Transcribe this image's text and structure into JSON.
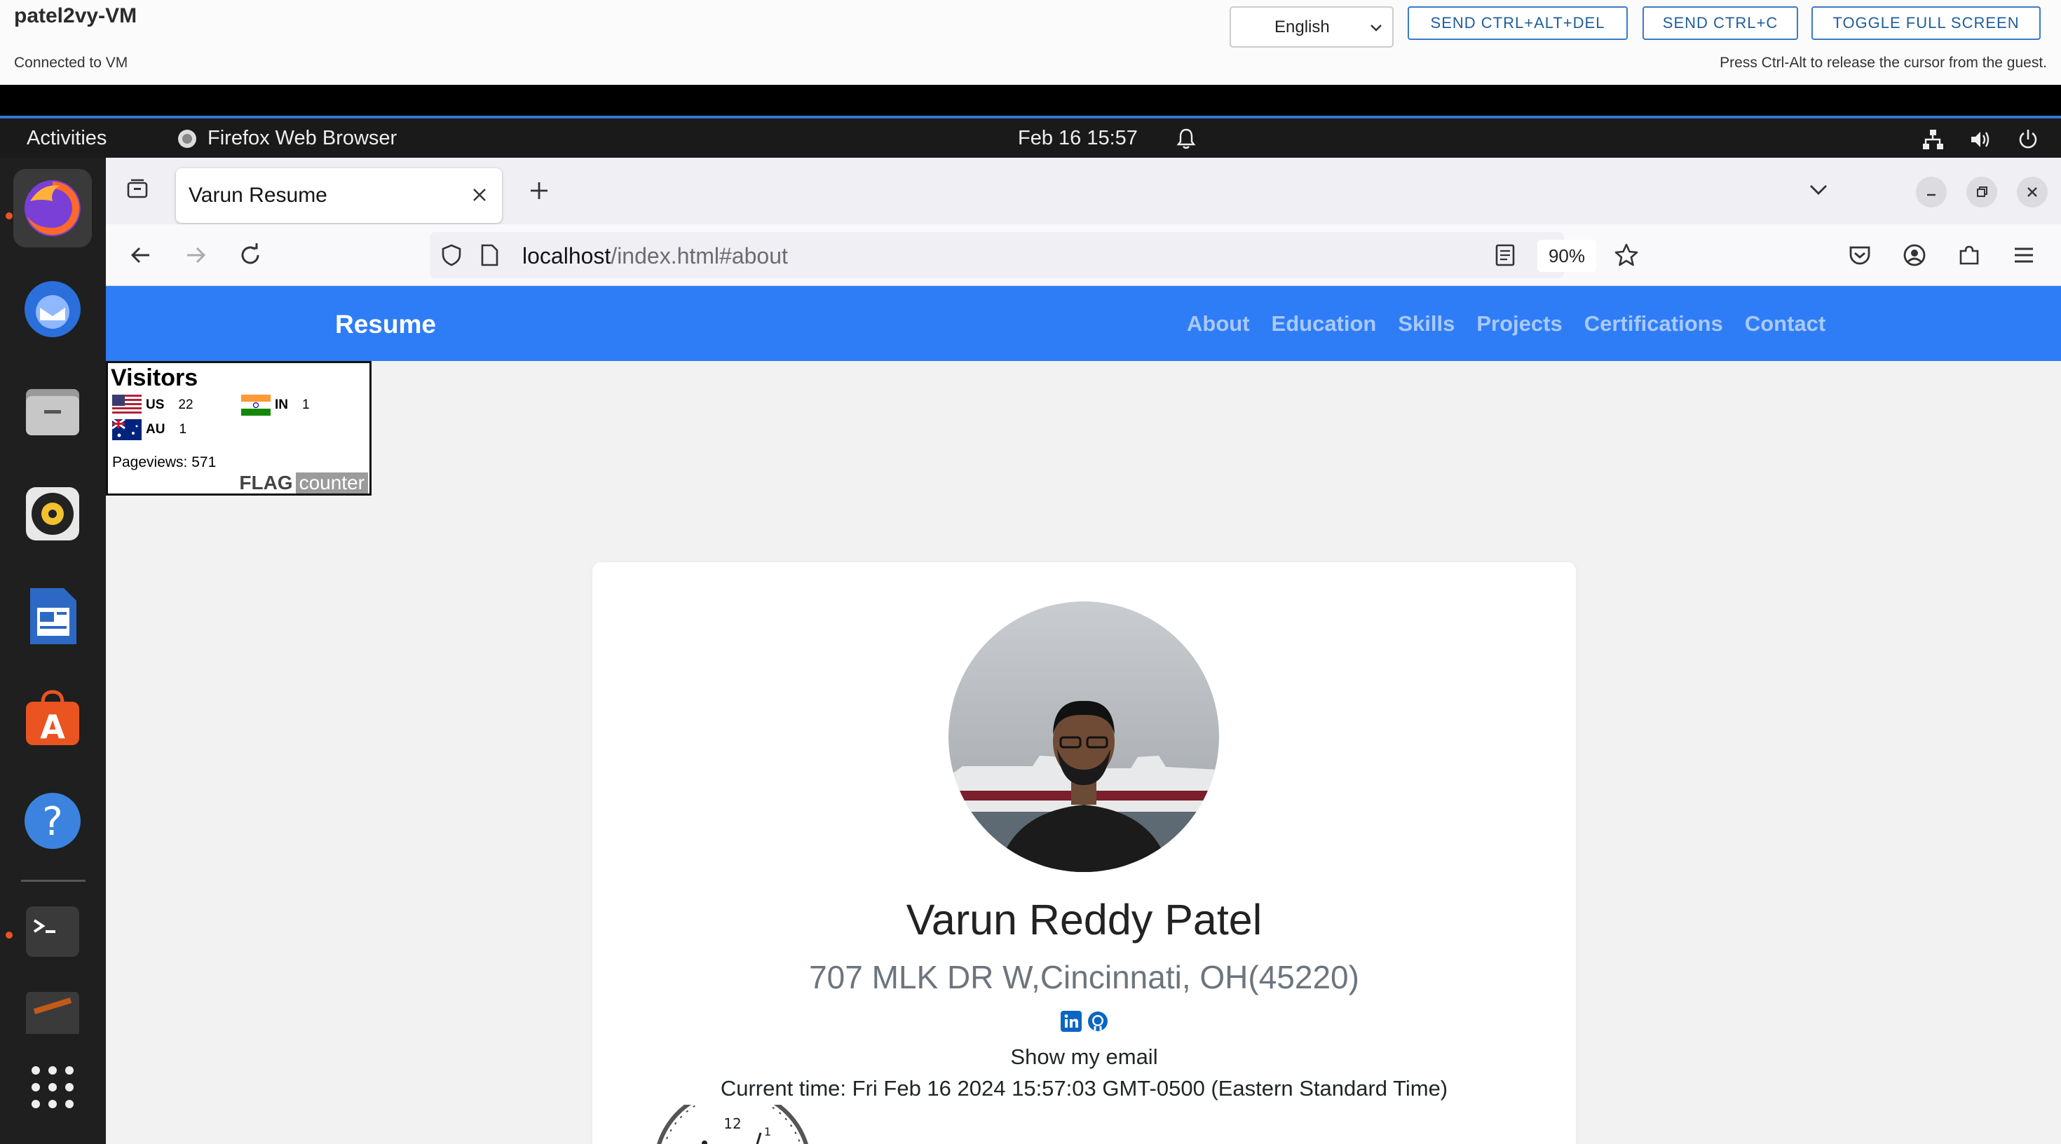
{
  "vm": {
    "title": "patel2vy-VM",
    "status": "Connected to VM",
    "language": "English",
    "buttons": {
      "ctrl_alt_del": "SEND CTRL+ALT+DEL",
      "ctrl_c": "SEND CTRL+C",
      "fullscreen": "TOGGLE FULL SCREEN"
    },
    "release_hint": "Press Ctrl-Alt to release the cursor from the guest."
  },
  "ubuntu": {
    "activities": "Activities",
    "app_name": "Firefox Web Browser",
    "clock": "Feb 16  15:57",
    "accent": "#e95420"
  },
  "dock": {
    "items": [
      "firefox",
      "thunderbird",
      "files",
      "rhythmbox",
      "libreoffice-writer",
      "ubuntu-software",
      "help",
      "terminal",
      "drive",
      "show-applications"
    ]
  },
  "browser": {
    "tab_title": "Varun Resume",
    "url_host": "localhost",
    "url_path": "/index.html#about",
    "zoom": "90%"
  },
  "site": {
    "brand": "Resume",
    "nav": [
      "About",
      "Education",
      "Skills",
      "Projects",
      "Certifications",
      "Contact"
    ],
    "brand_color": "#2f7df6"
  },
  "flag_counter": {
    "title": "Visitors",
    "rows": [
      {
        "code": "US",
        "count": "22"
      },
      {
        "code": "IN",
        "count": "1"
      },
      {
        "code": "AU",
        "count": "1"
      }
    ],
    "pageviews_label": "Pageviews:",
    "pageviews": "571",
    "logo_flag": "FLAG",
    "logo_counter": "counter"
  },
  "profile": {
    "name": "Varun Reddy Patel",
    "address": "707 MLK DR W,Cincinnati, OH(45220)",
    "show_email": "Show my email",
    "current_time": "Current time: Fri Feb 16 2024 15:57:03 GMT-0500 (Eastern Standard Time)",
    "clock_number_12": "12",
    "clock_number_1": "1"
  }
}
